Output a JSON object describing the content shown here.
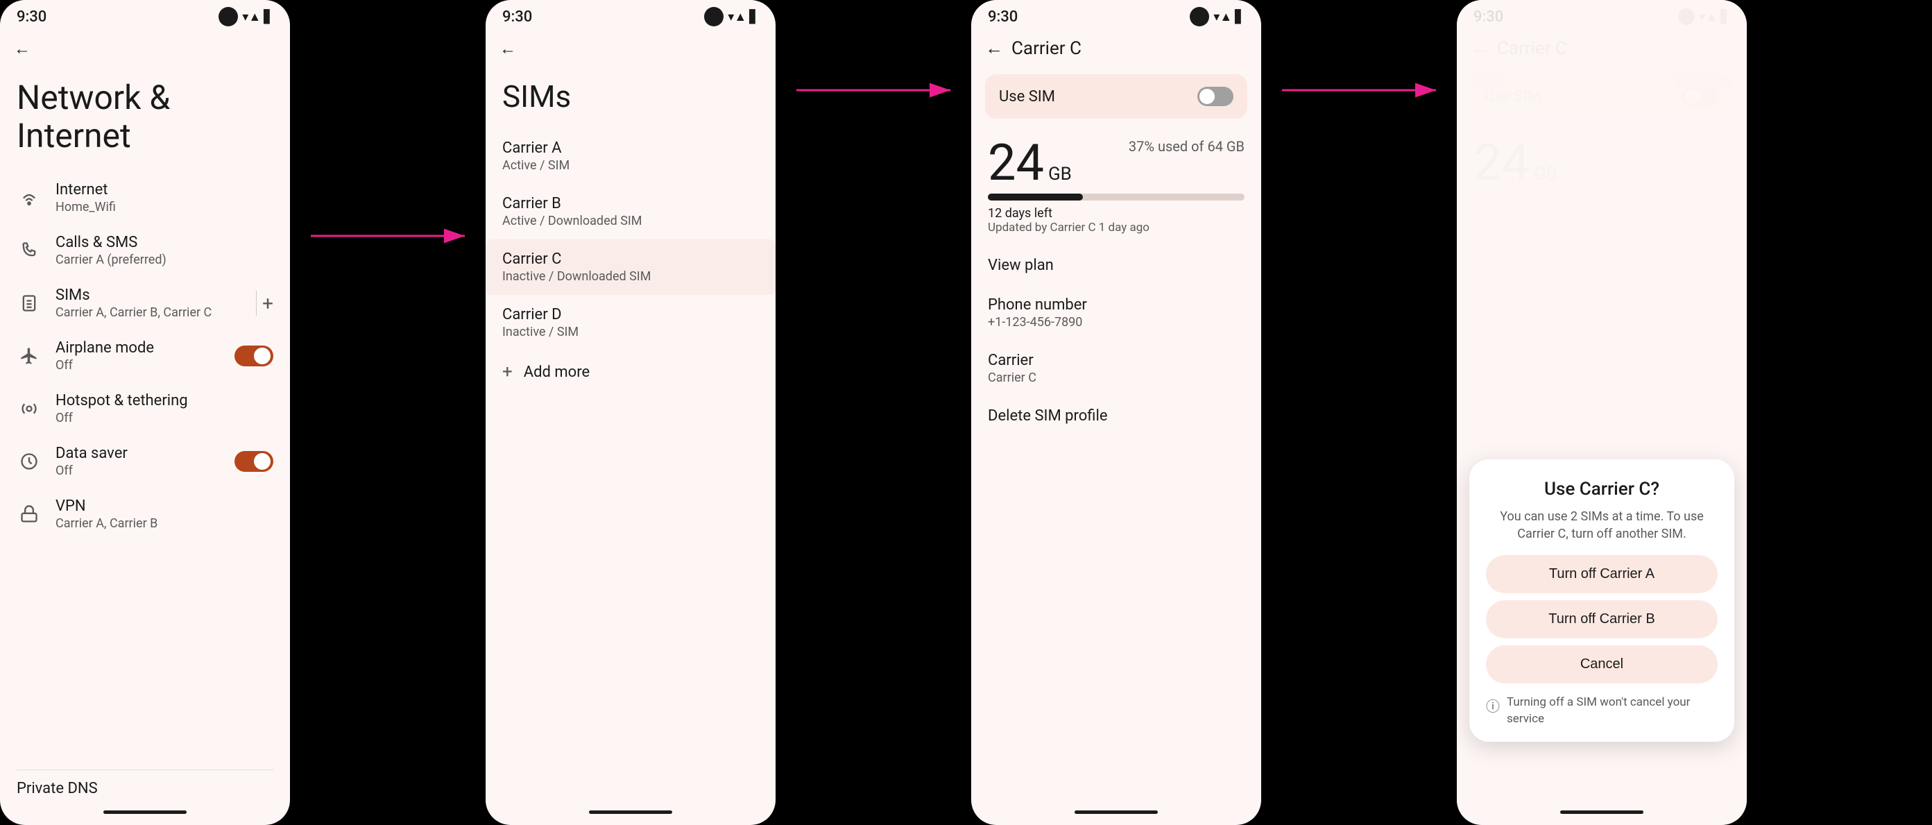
{
  "panel1": {
    "status_time": "9:30",
    "title": "Network & Internet",
    "back_arrow": "←",
    "menu_items": [
      {
        "icon": "wifi",
        "label": "Internet",
        "sub": "Home_Wifi",
        "name": "internet"
      },
      {
        "icon": "phone",
        "label": "Calls & SMS",
        "sub": "Carrier A (preferred)",
        "name": "calls-sms"
      },
      {
        "icon": "sim",
        "label": "SIMs",
        "sub": "Carrier A, Carrier B, Carrier C",
        "name": "sims",
        "has_divider": true,
        "has_plus": true
      },
      {
        "icon": "airplane",
        "label": "Airplane mode",
        "sub": "Off",
        "name": "airplane-mode",
        "has_toggle": true,
        "toggle_on": true
      },
      {
        "icon": "hotspot",
        "label": "Hotspot & tethering",
        "sub": "Off",
        "name": "hotspot"
      },
      {
        "icon": "data",
        "label": "Data saver",
        "sub": "Off",
        "name": "data-saver",
        "has_toggle": true,
        "toggle_on": true
      },
      {
        "icon": "vpn",
        "label": "VPN",
        "sub": "Carrier A, Carrier B",
        "name": "vpn"
      }
    ],
    "private_dns_label": "Private DNS"
  },
  "panel2": {
    "status_time": "9:30",
    "title": "SIMs",
    "back_arrow": "←",
    "carriers": [
      {
        "name": "Carrier A",
        "status": "Active / SIM"
      },
      {
        "name": "Carrier B",
        "status": "Active / Downloaded SIM"
      },
      {
        "name": "Carrier C",
        "status": "Inactive / Downloaded SIM",
        "highlighted": true
      },
      {
        "name": "Carrier D",
        "status": "Inactive / SIM"
      }
    ],
    "add_more_label": "Add more"
  },
  "panel3": {
    "status_time": "9:30",
    "back_arrow": "←",
    "page_title": "Carrier C",
    "use_sim_label": "Use SIM",
    "data_gb": "24",
    "data_unit": "GB",
    "data_percent": "37% used of 64 GB",
    "data_days": "12 days left",
    "data_updated": "Updated by Carrier C 1 day ago",
    "view_plan_label": "View plan",
    "phone_number_label": "Phone number",
    "phone_number_value": "+1-123-456-7890",
    "carrier_label": "Carrier",
    "carrier_value": "Carrier C",
    "delete_sim_label": "Delete SIM profile"
  },
  "panel4": {
    "status_time": "9:30",
    "back_arrow": "←",
    "page_title": "Carrier C",
    "use_sim_label": "Use SIM",
    "data_gb": "24",
    "dialog": {
      "title": "Use Carrier C?",
      "description": "You can use 2 SIMs at a time. To use Carrier C, turn off another SIM.",
      "btn1": "Turn off Carrier A",
      "btn2": "Turn off Carrier B",
      "btn3": "Cancel",
      "notice": "Turning off a SIM won't cancel your service"
    }
  }
}
